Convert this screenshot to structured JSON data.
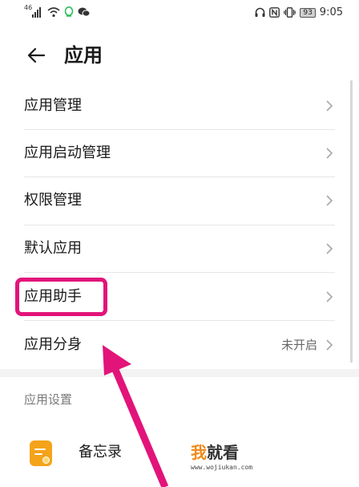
{
  "status_bar": {
    "signal": "46",
    "battery": "93",
    "time": "9:05"
  },
  "header": {
    "title": "应用"
  },
  "menu": [
    {
      "label": "应用管理"
    },
    {
      "label": "应用启动管理"
    },
    {
      "label": "权限管理"
    },
    {
      "label": "默认应用"
    },
    {
      "label": "应用助手"
    },
    {
      "label": "应用分身",
      "value": "未开启"
    }
  ],
  "section": {
    "title": "应用设置"
  },
  "apps": [
    {
      "name": "备忘录",
      "icon": "notepad-icon"
    }
  ],
  "watermark": {
    "char1": "我",
    "char2": "就看",
    "url": "www.wojiukan.com"
  },
  "colors": {
    "highlight": "#e2147a",
    "app_icon": "#f4a31b",
    "watermark_accent": "#f08a1a"
  }
}
